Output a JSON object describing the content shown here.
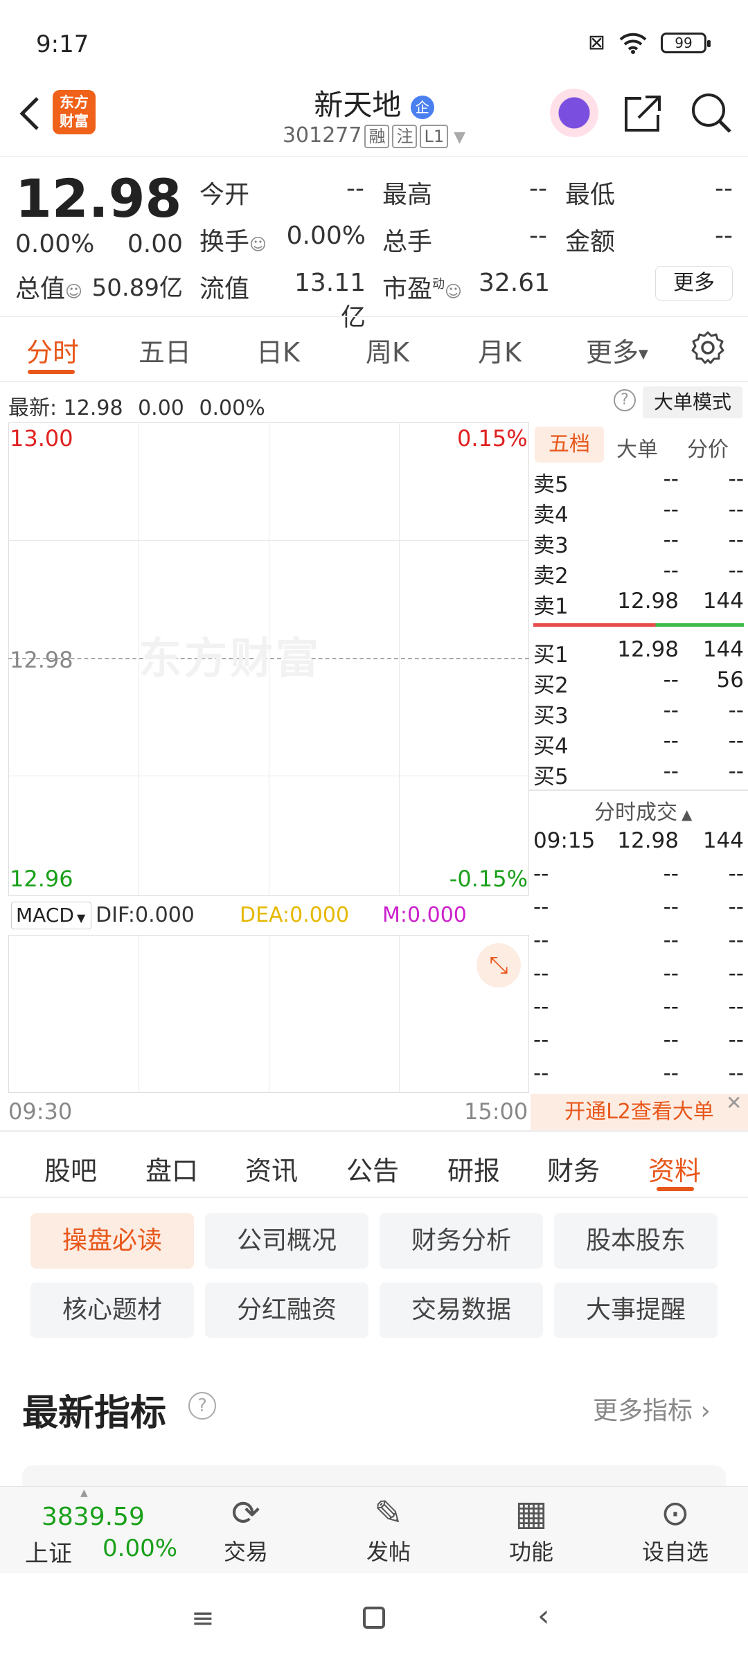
{
  "status": {
    "time": "9:17",
    "battery": "99"
  },
  "header": {
    "logo": "东方财富",
    "name": "新天地",
    "badge": "企",
    "code": "301277",
    "tags": [
      "融",
      "注",
      "L1"
    ]
  },
  "quote": {
    "price": "12.98",
    "change_pct": "0.00%",
    "change": "0.00",
    "open_label": "今开",
    "open": "--",
    "high_label": "最高",
    "high": "--",
    "low_label": "最低",
    "low": "--",
    "turnover_label": "换手",
    "turnover": "0.00%",
    "volume_label": "总手",
    "volume": "--",
    "amount_label": "金额",
    "amount": "--",
    "mktcap_label": "总值",
    "mktcap": "50.89亿",
    "float_label": "流值",
    "float": "13.11亿",
    "pe_label": "市盈",
    "pe_sup": "动",
    "pe": "32.61",
    "more": "更多"
  },
  "period_tabs": [
    "分时",
    "五日",
    "日K",
    "周K",
    "月K",
    "更多"
  ],
  "chart": {
    "latest_label": "最新:",
    "latest_price": "12.98",
    "latest_change": "0.00",
    "latest_pct": "0.00%",
    "mode_button": "大单模式",
    "y_top": "13.00",
    "y_mid": "12.98",
    "y_bottom": "12.96",
    "pct_top": "0.15%",
    "pct_bottom": "-0.15%",
    "watermark": "东方财富",
    "time_start": "09:30",
    "time_end": "15:00",
    "macd": {
      "selector": "MACD",
      "dif": "DIF:0.000",
      "dea": "DEA:0.000",
      "m": "M:0.000"
    }
  },
  "orderbook": {
    "tabs": [
      "五档",
      "大单",
      "分价"
    ],
    "sells": [
      {
        "label": "卖5",
        "price": "--",
        "vol": "--"
      },
      {
        "label": "卖4",
        "price": "--",
        "vol": "--"
      },
      {
        "label": "卖3",
        "price": "--",
        "vol": "--"
      },
      {
        "label": "卖2",
        "price": "--",
        "vol": "--"
      },
      {
        "label": "卖1",
        "price": "12.98",
        "vol": "144"
      }
    ],
    "buys": [
      {
        "label": "买1",
        "price": "12.98",
        "vol": "144"
      },
      {
        "label": "买2",
        "price": "--",
        "vol": "56"
      },
      {
        "label": "买3",
        "price": "--",
        "vol": "--"
      },
      {
        "label": "买4",
        "price": "--",
        "vol": "--"
      },
      {
        "label": "买5",
        "price": "--",
        "vol": "--"
      }
    ],
    "trades_title": "分时成交",
    "trades": [
      {
        "time": "09:15",
        "price": "12.98",
        "vol": "144"
      },
      {
        "time": "--",
        "price": "--",
        "vol": "--"
      },
      {
        "time": "--",
        "price": "--",
        "vol": "--"
      },
      {
        "time": "--",
        "price": "--",
        "vol": "--"
      },
      {
        "time": "--",
        "price": "--",
        "vol": "--"
      },
      {
        "time": "--",
        "price": "--",
        "vol": "--"
      },
      {
        "time": "--",
        "price": "--",
        "vol": "--"
      },
      {
        "time": "--",
        "price": "--",
        "vol": "--"
      }
    ],
    "l2_banner": "开通L2查看大单"
  },
  "info_tabs": [
    "股吧",
    "盘口",
    "资讯",
    "公告",
    "研报",
    "财务",
    "资料"
  ],
  "chips": [
    "操盘必读",
    "公司概况",
    "财务分析",
    "股本股东",
    "核心题材",
    "分红融资",
    "交易数据",
    "大事提醒"
  ],
  "indicators": {
    "title": "最新指标",
    "more": "更多指标 ›"
  },
  "bottom_nav": {
    "index_value": "3839.59",
    "index_name": "上证",
    "index_pct": "0.00%",
    "items": [
      "交易",
      "发帖",
      "功能",
      "设自选"
    ]
  },
  "colors": {
    "accent": "#e8571a",
    "up": "#e02020",
    "down": "#1aa01a",
    "dea": "#e6b800",
    "m": "#cc22cc"
  }
}
